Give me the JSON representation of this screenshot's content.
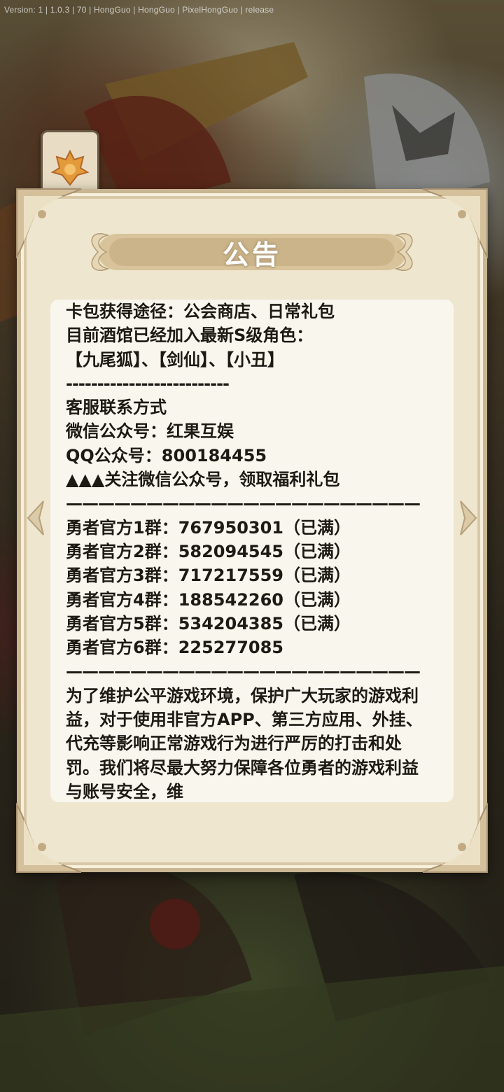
{
  "status": {
    "version": "Version: 1 | 1.0.3 | 70 | HongGuo | HongGuo | PixelHongGuo | release"
  },
  "dialog": {
    "title": "公告",
    "lines": [
      "卡包获得途径：公会商店、日常礼包",
      "目前酒馆已经加入最新S级角色：",
      "【九尾狐】、【剑仙】、【小丑】",
      "--------------------------",
      "客服联系方式",
      "微信公众号：红果互娱",
      "QQ公众号：800184455",
      "▲▲▲关注微信公众号，领取福利礼包",
      "——————————————————————",
      "勇者官方1群：767950301（已满）",
      "勇者官方2群：582094545（已满）",
      "勇者官方3群：717217559（已满）",
      "勇者官方4群：188542260（已满）",
      "勇者官方5群：534204385（已满）",
      "勇者官方6群：225277085",
      "——————————————————————"
    ],
    "paragraph": "为了维护公平游戏环境，保护广大玩家的游戏利益，对于使用非官方APP、第三方应用、外挂、代充等影响正常游戏行为进行严厉的打击和处罚。我们将尽最大努力保障各位勇者的游戏利益与账号安全，维"
  },
  "colors": {
    "panel": "#efe6cf",
    "border": "#c9b692",
    "content_bg": "#f9f6ee",
    "text": "#1d1a14"
  },
  "icons": {
    "badge": "guild-crest-icon"
  }
}
